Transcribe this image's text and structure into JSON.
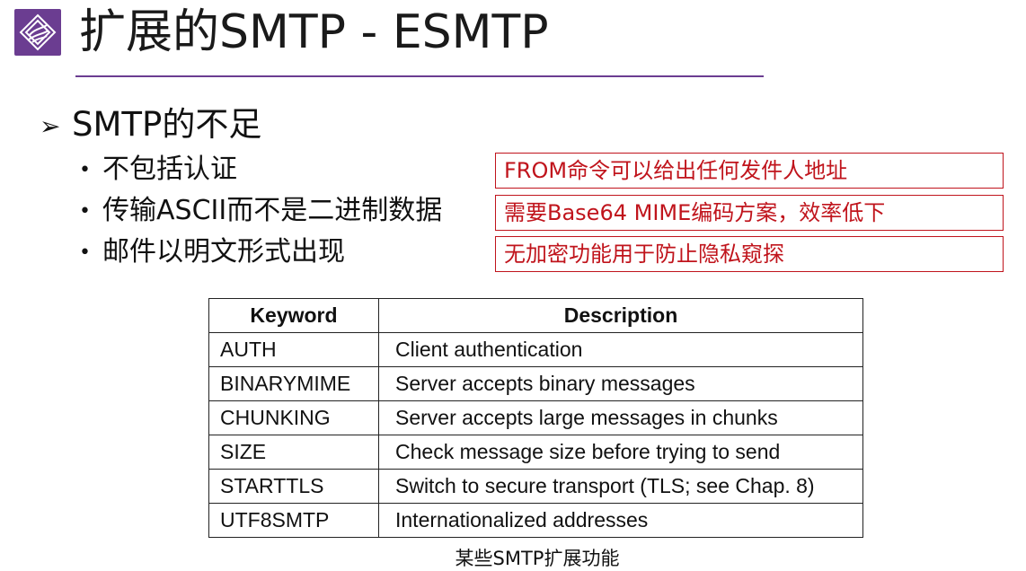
{
  "title": "扩展的SMTP - ESMTP",
  "main_bullet": {
    "marker": "➢",
    "text": "SMTP的不足"
  },
  "sub_bullets": [
    {
      "marker": "•",
      "text": "不包括认证",
      "note": "FROM命令可以给出任何发件人地址"
    },
    {
      "marker": "•",
      "text": "传输ASCII而不是二进制数据",
      "note": "需要Base64 MIME编码方案，效率低下"
    },
    {
      "marker": "•",
      "text": "邮件以明文形式出现",
      "note": "无加密功能用于防止隐私窥探"
    }
  ],
  "table": {
    "headers": [
      "Keyword",
      "Description"
    ],
    "rows": [
      [
        "AUTH",
        "Client authentication"
      ],
      [
        "BINARYMIME",
        "Server accepts binary messages"
      ],
      [
        "CHUNKING",
        "Server accepts large messages in chunks"
      ],
      [
        "SIZE",
        "Check message size before trying to send"
      ],
      [
        "STARTTLS",
        "Switch to secure transport (TLS; see Chap. 8)"
      ],
      [
        "UTF8SMTP",
        "Internationalized addresses"
      ]
    ],
    "caption": "某些SMTP扩展功能"
  },
  "colors": {
    "accent": "#6b3d91",
    "note": "#c0141c"
  },
  "icons": {
    "logo": "logo-icon"
  }
}
